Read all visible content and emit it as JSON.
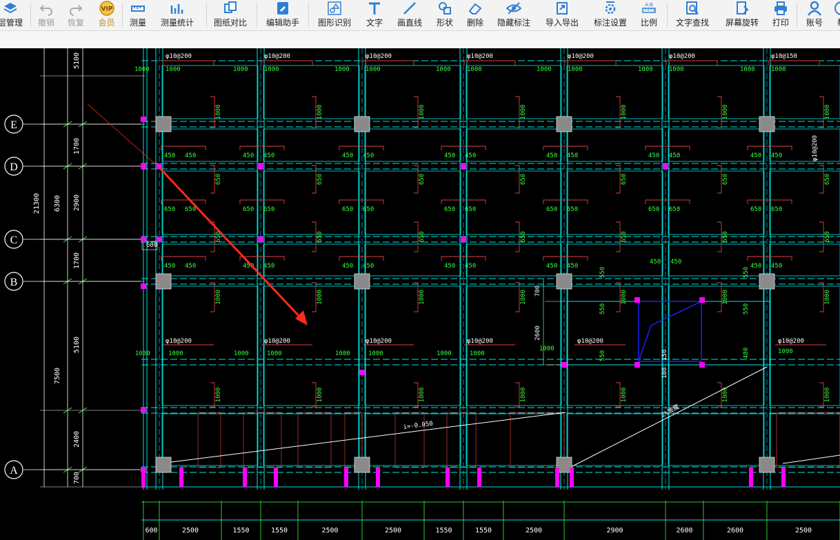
{
  "toolbar": {
    "items": [
      {
        "label": "层管理",
        "icon": "layers-icon",
        "state": "normal"
      },
      {
        "label": "撤销",
        "icon": "undo-icon",
        "state": "disabled"
      },
      {
        "label": "恢复",
        "icon": "redo-icon",
        "state": "disabled"
      },
      {
        "label": "会员",
        "icon": "vip-icon",
        "state": "vip"
      },
      {
        "label": "测量",
        "icon": "ruler-icon",
        "state": "normal"
      },
      {
        "label": "测量统计",
        "icon": "measure-stats-icon",
        "state": "normal"
      },
      {
        "label": "图纸对比",
        "icon": "compare-icon",
        "state": "normal"
      },
      {
        "label": "编辑助手",
        "icon": "edit-assistant-icon",
        "state": "normal"
      },
      {
        "label": "图形识别",
        "icon": "shape-recognize-icon",
        "state": "normal"
      },
      {
        "label": "文字",
        "icon": "text-icon",
        "state": "normal"
      },
      {
        "label": "画直线",
        "icon": "line-icon",
        "state": "normal"
      },
      {
        "label": "形状",
        "icon": "shapes-icon",
        "state": "normal"
      },
      {
        "label": "删除",
        "icon": "eraser-icon",
        "state": "normal"
      },
      {
        "label": "隐藏标注",
        "icon": "eye-icon",
        "state": "normal"
      },
      {
        "label": "导入导出",
        "icon": "import-export-icon",
        "state": "normal"
      },
      {
        "label": "标注设置",
        "icon": "annotation-settings-icon",
        "state": "normal"
      },
      {
        "label": "比例",
        "icon": "scale-icon",
        "state": "normal"
      },
      {
        "label": "文字查找",
        "icon": "text-search-icon",
        "state": "normal"
      },
      {
        "label": "屏幕旋转",
        "icon": "rotate-screen-icon",
        "state": "normal"
      },
      {
        "label": "打印",
        "icon": "print-icon",
        "state": "normal"
      },
      {
        "label": "账号",
        "icon": "account-icon",
        "state": "normal"
      },
      {
        "label": "帮",
        "icon": "help-icon",
        "state": "normal"
      }
    ],
    "icon_color": "#2f7fd6",
    "vip_color": "#c78a1e"
  },
  "drawing": {
    "axis_labels": [
      "E",
      "D",
      "C",
      "B",
      "A"
    ],
    "left_dims_outer": [
      "21300"
    ],
    "left_dims_mid": [
      "6300",
      "7500"
    ],
    "left_dims_inner": [
      "5100",
      "1700",
      "2900",
      "1700",
      "5100",
      "2400",
      "700"
    ],
    "bottom_dims": [
      "600",
      "2500",
      "1550",
      "1550",
      "2500",
      "2500",
      "1550",
      "1550",
      "2500",
      "2900",
      "2600",
      "2600",
      "2500"
    ],
    "top_rebar": [
      "φ10@200",
      "φ10@200",
      "φ10@200",
      "φ10@200",
      "φ10@200",
      "φ10@200",
      "φ10@150"
    ],
    "mid_rebar": [
      "φ10@200",
      "φ10@200",
      "φ10@200",
      "φ10@200",
      "φ10@200",
      "φ10@200"
    ],
    "side_rebar": "φ10@200",
    "slope_label_1": "i=-0.050",
    "slope_label_2": "2%坡度",
    "label_600": "600",
    "label_700": "700",
    "label_2600": "2600",
    "label_150": "150",
    "label_100": "100",
    "n1000": "1000",
    "n450": "450",
    "n650": "650",
    "n550": "550",
    "n480": "480",
    "colors": {
      "background": "#000000",
      "grid_line": "#00e5e5",
      "green_text": "#3cff3c",
      "red_line": "#e04040",
      "magenta": "#ff00ff",
      "column": "#8a8a8a",
      "annotation_arrow": "#ff2a1a",
      "blue_outline": "#2020ff"
    }
  }
}
